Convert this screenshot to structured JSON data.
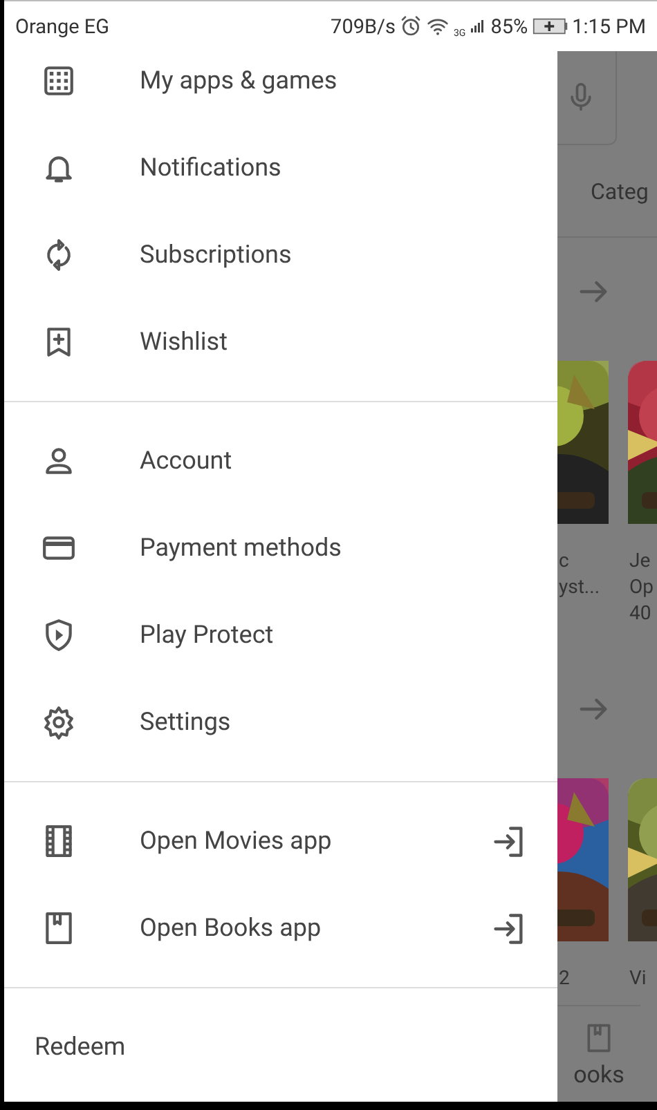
{
  "status_bar": {
    "carrier": "Orange EG",
    "speed": "709B/s",
    "network": "3G",
    "battery": "85%",
    "time": "1:15 PM"
  },
  "drawer": {
    "sections": [
      {
        "items": [
          {
            "label": "My apps & games"
          },
          {
            "label": "Notifications"
          },
          {
            "label": "Subscriptions"
          },
          {
            "label": "Wishlist"
          }
        ]
      },
      {
        "items": [
          {
            "label": "Account"
          },
          {
            "label": "Payment methods"
          },
          {
            "label": "Play Protect"
          },
          {
            "label": "Settings"
          }
        ]
      },
      {
        "items": [
          {
            "label": "Open Movies app",
            "kind": "app-link"
          },
          {
            "label": "Open Books app",
            "kind": "app-link"
          }
        ]
      },
      {
        "items": [
          {
            "label": "Redeem",
            "kind": "text"
          }
        ]
      }
    ]
  },
  "background": {
    "category_tab": "Categ",
    "rows": [
      {
        "apps": [
          {
            "lines": [
              "c",
              "yst..."
            ]
          },
          {
            "lines": [
              "Je",
              "Op",
              "40"
            ]
          }
        ]
      },
      {
        "apps": [
          {
            "lines": [
              "2"
            ]
          },
          {
            "lines": [
              "Vi"
            ]
          }
        ]
      }
    ],
    "bottom_nav": "ooks"
  }
}
